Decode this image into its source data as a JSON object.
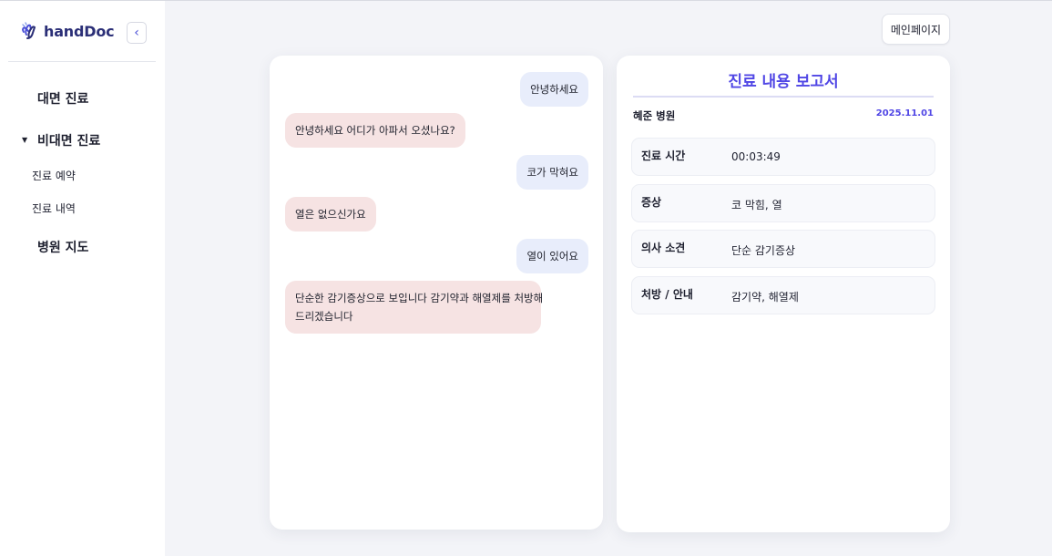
{
  "brand": {
    "name": "handDoc",
    "logo_icon": "hand-wave-icon"
  },
  "sidebar": {
    "collapse_icon": "chevron-left-icon",
    "items": [
      {
        "label": "대면 진료"
      },
      {
        "label": "비대면 진료",
        "expanded": true,
        "children": [
          {
            "label": "진료 예약"
          },
          {
            "label": "진료 내역"
          }
        ]
      },
      {
        "label": "병원 지도"
      }
    ]
  },
  "header": {
    "main_page_label": "메인페이지"
  },
  "chat": {
    "messages": [
      {
        "role": "user",
        "text": "안녕하세요"
      },
      {
        "role": "bot",
        "text": "안녕하세요 어디가 아파서 오셨나요?"
      },
      {
        "role": "user",
        "text": "코가 막혀요"
      },
      {
        "role": "bot",
        "text": "열은 없으신가요"
      },
      {
        "role": "user",
        "text": "열이 있어요"
      },
      {
        "role": "bot",
        "text_line1": "단순한 감기증상으로 보입니다 감기약과 해열제를 처방해",
        "text_line2": "드리겠습니다"
      }
    ]
  },
  "report": {
    "title": "진료 내용 보고서",
    "hospital": "혜준 병원",
    "date": "2025.11.01",
    "rows": [
      {
        "label": "진료 시간",
        "value": "00:03:49"
      },
      {
        "label": "증상",
        "value": "코 막힘, 열"
      },
      {
        "label": "의사 소견",
        "value": "단순 감기증상"
      },
      {
        "label": "처방 / 안내",
        "value": "감기약, 해열제"
      }
    ]
  },
  "colors": {
    "accent": "#5046e5",
    "user_bubble": "#e8edfb",
    "bot_bubble": "#f6e3e3"
  }
}
